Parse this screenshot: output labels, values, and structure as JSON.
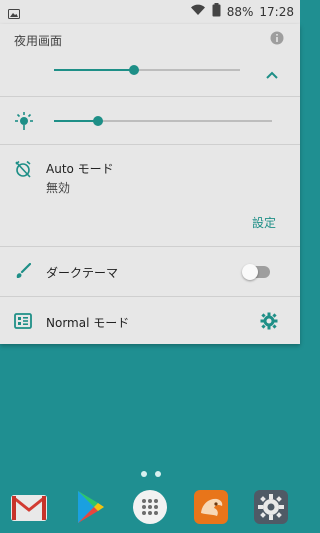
{
  "status_bar": {
    "battery_percent": "88%",
    "time": "17:28",
    "icons": [
      "image-icon",
      "moon-icon",
      "wifi-icon",
      "battery-icon"
    ]
  },
  "panel": {
    "title": "夜用画面",
    "night_slider_level": 0.43,
    "brightness_slider_level": 0.2,
    "auto_mode": {
      "label": "Auto モード",
      "value": "無効"
    },
    "settings_link": "設定",
    "dark_theme": {
      "label": "ダークテーマ",
      "enabled": false
    },
    "normal_mode": {
      "label": "Normal モード"
    },
    "accent_color": "#1e8f87"
  },
  "home": {
    "page_dots": 2,
    "dock_apps": [
      "Gmail",
      "Play Store",
      "App drawer",
      "CM Browser",
      "Settings"
    ]
  }
}
